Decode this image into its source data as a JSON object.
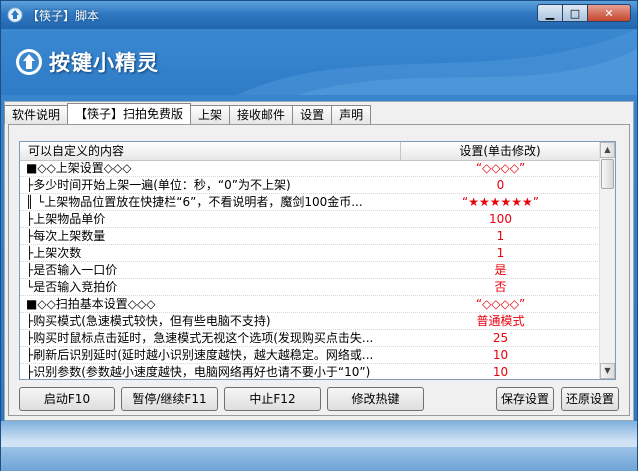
{
  "window": {
    "title": "【筷子】脚本",
    "min_glyph": "▁",
    "max_glyph": "□",
    "close_glyph": "✕"
  },
  "brand": {
    "name": "按键小精灵"
  },
  "tabs": [
    {
      "label": "软件说明",
      "active": false
    },
    {
      "label": "【筷子】扫拍免费版",
      "active": true
    },
    {
      "label": "上架",
      "active": false
    },
    {
      "label": "接收邮件",
      "active": false
    },
    {
      "label": "设置",
      "active": false
    },
    {
      "label": "声明",
      "active": false
    }
  ],
  "grid": {
    "headers": {
      "name": "可以自定义的内容",
      "value": "设置(单击修改)"
    },
    "rows": [
      {
        "name": "■◇◇上架设置◇◇◇",
        "value": "“◇◇◇◇”"
      },
      {
        "name": "  ├多少时间开始上架一遍(单位：秒，“0”为不上架)",
        "value": "0"
      },
      {
        "name": "  ║  └上架物品位置放在快捷栏“6”，不看说明者，魔剑100金币...",
        "value": "“★★★★★★”"
      },
      {
        "name": "  ├上架物品单价",
        "value": "100"
      },
      {
        "name": "  ├每次上架数量",
        "value": "1"
      },
      {
        "name": "  ├上架次数",
        "value": "1"
      },
      {
        "name": "  ├是否输入一口价",
        "value": "是"
      },
      {
        "name": "  └是否输入竞拍价",
        "value": "否"
      },
      {
        "name": "■◇◇扫拍基本设置◇◇◇",
        "value": "“◇◇◇◇”"
      },
      {
        "name": "  ├购买模式(急速模式较快，但有些电脑不支持)",
        "value": "普通模式"
      },
      {
        "name": "  ├购买时鼠标点击延时，急速模式无视这个选项(发现购买点击失...",
        "value": "25"
      },
      {
        "name": "  ├刷新后识别延时(延时越小识别速度越快，越大越稳定。网络或...",
        "value": "10"
      },
      {
        "name": "  ├识别参数(参数越小速度越快，电脑网络再好也请不要小于“10”)",
        "value": "10"
      }
    ]
  },
  "buttons": {
    "start": "启动F10",
    "pause": "暂停/继续F11",
    "stop": "中止F12",
    "hotkey": "修改热键",
    "save": "保存设置",
    "restore": "还原设置"
  },
  "scrollbar": {
    "up_glyph": "▲",
    "down_glyph": "▼"
  },
  "colors": {
    "value_red": "#e8000b",
    "title_blue": "#2f78c2"
  }
}
